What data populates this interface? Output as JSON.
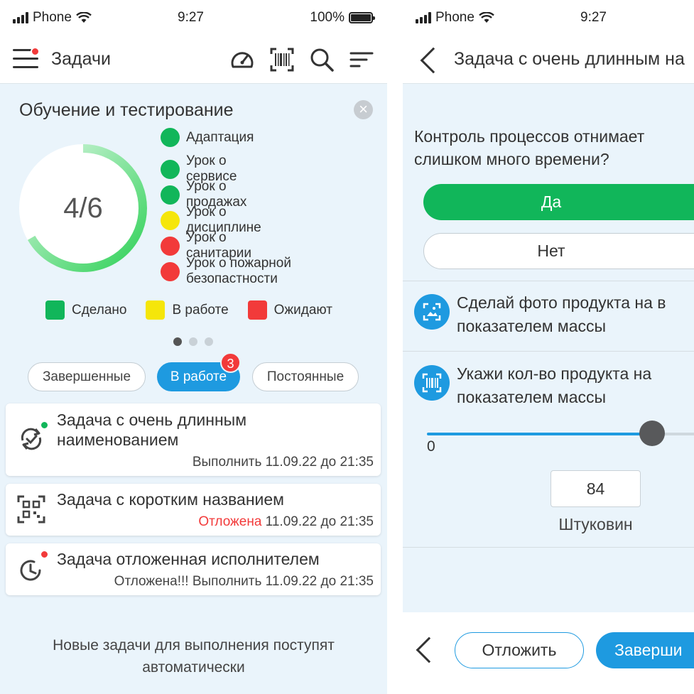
{
  "status_bar": {
    "carrier": "Phone",
    "time": "9:27",
    "battery": "100%"
  },
  "task_list_screen": {
    "title": "Задачи",
    "training_card": {
      "title": "Обучение и тестирование",
      "progress_text": "4/6",
      "progress_fraction": 0.6667,
      "lessons": [
        {
          "label": "Адаптация",
          "status": "done"
        },
        {
          "label": "Урок о сервисе",
          "status": "done"
        },
        {
          "label": "Урок о продажах",
          "status": "done"
        },
        {
          "label": "Урок о дисциплине",
          "status": "in_progress"
        },
        {
          "label": "Урок о санитарии",
          "status": "waiting"
        },
        {
          "label": "Урок о пожарной безопастности",
          "status": "waiting"
        }
      ],
      "status_legend": {
        "done": "Сделано",
        "in_progress": "В работе",
        "waiting": "Ожидают"
      },
      "pager": {
        "pages": 3,
        "active": 0
      }
    },
    "tabs": [
      {
        "label": "Завершенные",
        "active": false
      },
      {
        "label": "В работе",
        "active": true,
        "badge": "3"
      },
      {
        "label": "Постоянные",
        "active": false
      }
    ],
    "tasks": [
      {
        "name": "Задача с очень длинным наименованием",
        "icon": "sync-check-icon",
        "dot": "green",
        "status_prefix": "",
        "meta": "Выполнить 11.09.22 до 21:35"
      },
      {
        "name": "Задача с коротким названием",
        "icon": "qr-code-icon",
        "dot": "",
        "status_prefix": "Отложена",
        "meta": " 11.09.22 до 21:35"
      },
      {
        "name": "Задача отложенная исполнителем",
        "icon": "clock-return-icon",
        "dot": "red",
        "status_prefix": "Отложена!!! Выполнить 11.09.22 до 21:35",
        "meta": ""
      }
    ],
    "footer_note": "Новые задачи для выполнения поступят автоматически"
  },
  "task_detail_screen": {
    "title": "Задача с очень длинным на",
    "question": "Контроль процессов отнимает слишком много времени?",
    "answers": {
      "yes": "Да",
      "no": "Нет",
      "selected": "yes"
    },
    "photo_step": {
      "line1": "Сделай фото продукта на в",
      "line2": "показателем массы"
    },
    "count_step": {
      "line1": "Укажи кол-во продукта на",
      "line2": "показателем массы"
    },
    "slider": {
      "min_label": "0",
      "value": 84
    },
    "quantity": {
      "value": "84",
      "unit": "Штуковин"
    },
    "bottom_bar": {
      "postpone": "Отложить",
      "finish": "Заверши"
    }
  },
  "colors": {
    "done": "#11b65a",
    "in_progress": "#f5e60a",
    "waiting": "#f23a3a",
    "accent": "#1e9ae0",
    "screen_bg": "#eaf4fb"
  }
}
